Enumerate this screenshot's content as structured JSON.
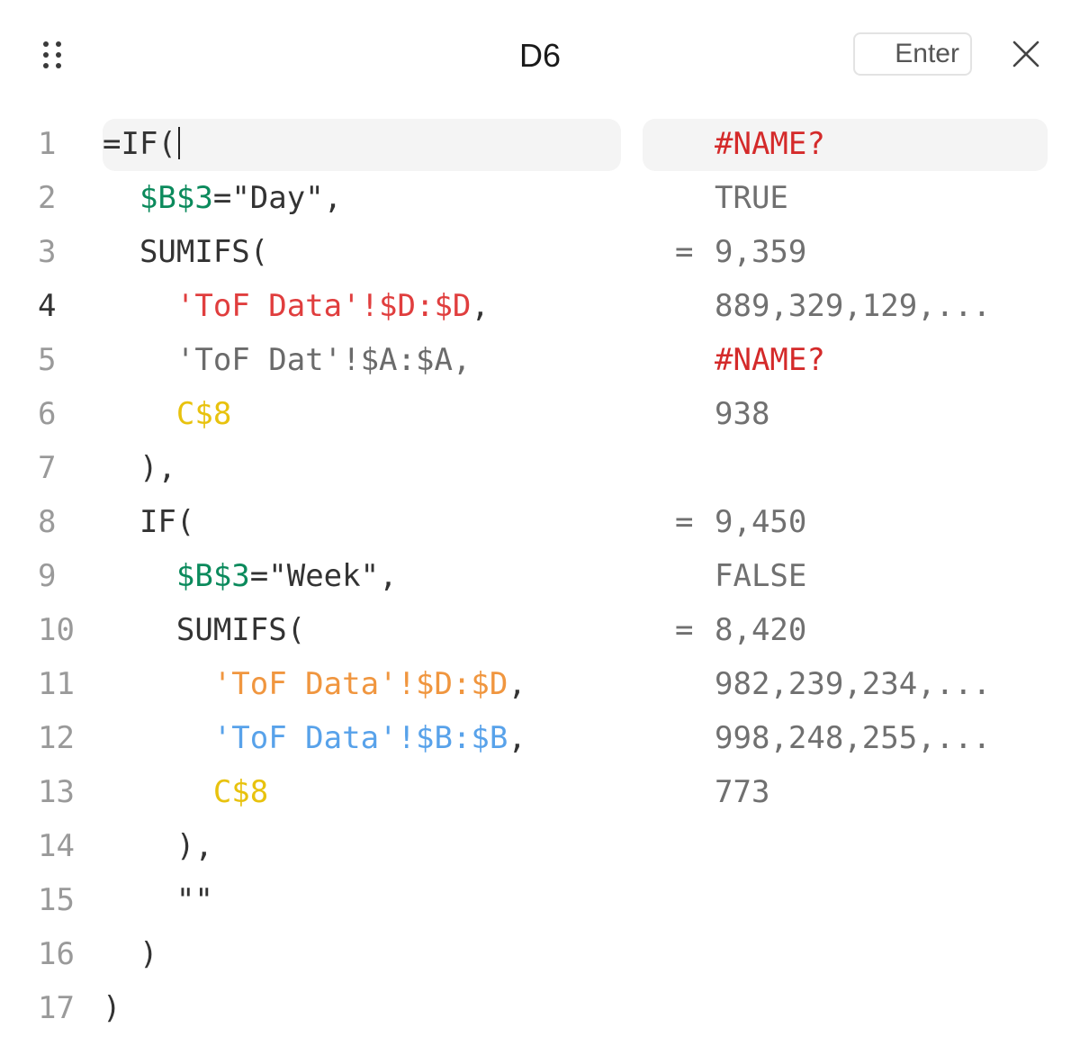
{
  "header": {
    "cell_ref": "D6",
    "enter_label": "Enter",
    "drag_icon": "drag-handle-icon",
    "close_icon": "close-icon"
  },
  "colors": {
    "green": "#0b8a5c",
    "red": "#e03e3e",
    "yellow": "#e8c20e",
    "orange": "#f0963f",
    "blue": "#58a2ea",
    "error": "#d42a2a"
  },
  "lines": [
    {
      "num": "1",
      "indent": "",
      "tokens": [
        {
          "t": "=IF(",
          "c": ""
        }
      ],
      "cursor": true,
      "eq": "",
      "result": "#NAME?",
      "error": true
    },
    {
      "num": "2",
      "indent": "  ",
      "tokens": [
        {
          "t": "$B$3",
          "c": "green"
        },
        {
          "t": "=\"Day\",",
          "c": ""
        }
      ],
      "eq": "",
      "result": "TRUE"
    },
    {
      "num": "3",
      "indent": "  ",
      "tokens": [
        {
          "t": "SUMIFS(",
          "c": ""
        }
      ],
      "eq": "=",
      "result": "9,359"
    },
    {
      "num": "4",
      "indent": "    ",
      "tokens": [
        {
          "t": "'ToF Data'!$D:$D",
          "c": "red"
        },
        {
          "t": ",",
          "c": ""
        }
      ],
      "eq": "",
      "result": "889,329,129,...",
      "active": true
    },
    {
      "num": "5",
      "indent": "    ",
      "tokens": [
        {
          "t": "'ToF Dat'!$A:$A,",
          "c": "gray"
        }
      ],
      "eq": "",
      "result": "#NAME?",
      "error": true
    },
    {
      "num": "6",
      "indent": "    ",
      "tokens": [
        {
          "t": "C$8",
          "c": "yellow"
        }
      ],
      "eq": "",
      "result": "938"
    },
    {
      "num": "7",
      "indent": "  ",
      "tokens": [
        {
          "t": "),",
          "c": ""
        }
      ],
      "eq": "",
      "result": ""
    },
    {
      "num": "8",
      "indent": "  ",
      "tokens": [
        {
          "t": "IF(",
          "c": ""
        }
      ],
      "eq": "=",
      "result": "9,450"
    },
    {
      "num": "9",
      "indent": "    ",
      "tokens": [
        {
          "t": "$B$3",
          "c": "green"
        },
        {
          "t": "=\"Week\",",
          "c": ""
        }
      ],
      "eq": "",
      "result": "FALSE"
    },
    {
      "num": "10",
      "indent": "    ",
      "tokens": [
        {
          "t": "SUMIFS(",
          "c": ""
        }
      ],
      "eq": "=",
      "result": "8,420"
    },
    {
      "num": "11",
      "indent": "      ",
      "tokens": [
        {
          "t": "'ToF Data'!$D:$D",
          "c": "orange"
        },
        {
          "t": ",",
          "c": ""
        }
      ],
      "eq": "",
      "result": "982,239,234,..."
    },
    {
      "num": "12",
      "indent": "      ",
      "tokens": [
        {
          "t": "'ToF Data'!$B:$B",
          "c": "blue"
        },
        {
          "t": ",",
          "c": ""
        }
      ],
      "eq": "",
      "result": "998,248,255,..."
    },
    {
      "num": "13",
      "indent": "      ",
      "tokens": [
        {
          "t": "C$8",
          "c": "yellow"
        }
      ],
      "eq": "",
      "result": "773"
    },
    {
      "num": "14",
      "indent": "    ",
      "tokens": [
        {
          "t": "),",
          "c": ""
        }
      ],
      "eq": "",
      "result": ""
    },
    {
      "num": "15",
      "indent": "    ",
      "tokens": [
        {
          "t": "\"\"",
          "c": ""
        }
      ],
      "eq": "",
      "result": ""
    },
    {
      "num": "16",
      "indent": "  ",
      "tokens": [
        {
          "t": ")",
          "c": ""
        }
      ],
      "eq": "",
      "result": ""
    },
    {
      "num": "17",
      "indent": "",
      "tokens": [
        {
          "t": ")",
          "c": ""
        }
      ],
      "eq": "",
      "result": ""
    }
  ]
}
